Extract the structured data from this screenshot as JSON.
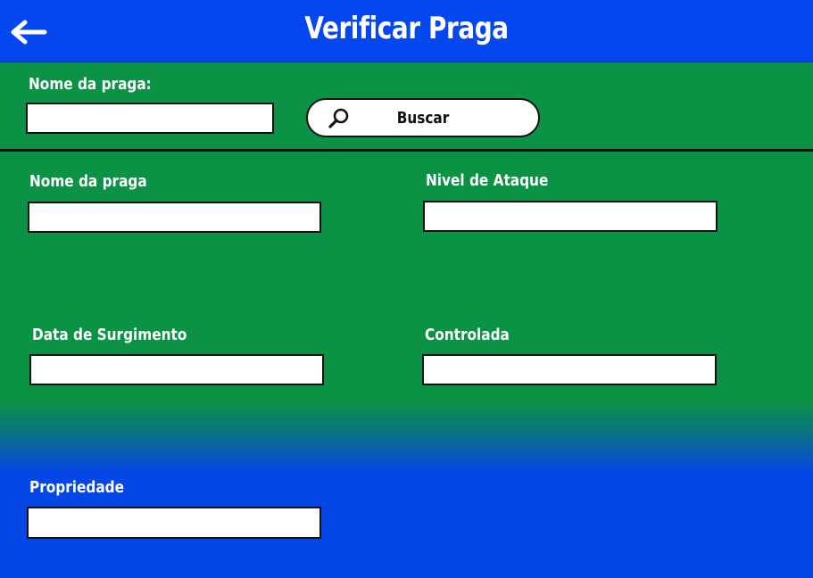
{
  "header": {
    "title": "Verificar Praga",
    "back_icon": "arrow-left-icon",
    "background": "#0547ee"
  },
  "search": {
    "label": "Nome da praga:",
    "value": "",
    "button_label": "Buscar",
    "button_icon": "search-icon"
  },
  "form": {
    "nome_label": "Nome da praga",
    "nome_value": "",
    "nivel_label": "Nivel de Ataque",
    "nivel_value": "",
    "data_label": "Data de Surgimento",
    "data_value": "",
    "controlada_label": "Controlada",
    "controlada_value": "",
    "propriedade_label": "Propriedade",
    "propriedade_value": ""
  },
  "colors": {
    "green": "#0b9245",
    "blue": "#0546e6"
  }
}
